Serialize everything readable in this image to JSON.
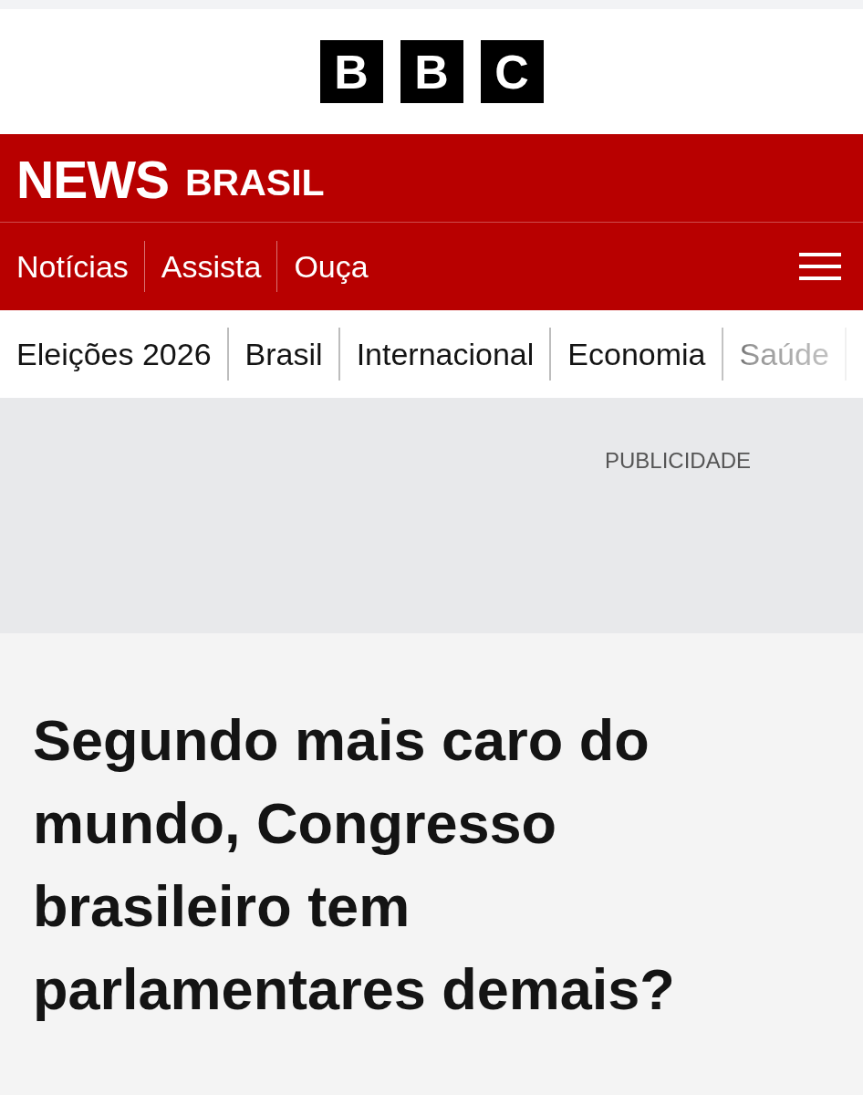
{
  "logo": {
    "letters": [
      "B",
      "B",
      "C"
    ]
  },
  "brand_bar": {
    "title": "NEWS",
    "subtitle": "BRASIL"
  },
  "main_nav": {
    "items": [
      {
        "label": "Notícias"
      },
      {
        "label": "Assista"
      },
      {
        "label": "Ouça"
      }
    ]
  },
  "topic_nav": {
    "items": [
      {
        "label": "Eleições 2026"
      },
      {
        "label": "Brasil"
      },
      {
        "label": "Internacional"
      },
      {
        "label": "Economia"
      },
      {
        "label": "Saúde"
      }
    ]
  },
  "advert": {
    "label": "PUBLICIDADE"
  },
  "article": {
    "headline": "Segundo mais caro do mundo, Congresso brasileiro tem parlamentares demais?"
  }
}
